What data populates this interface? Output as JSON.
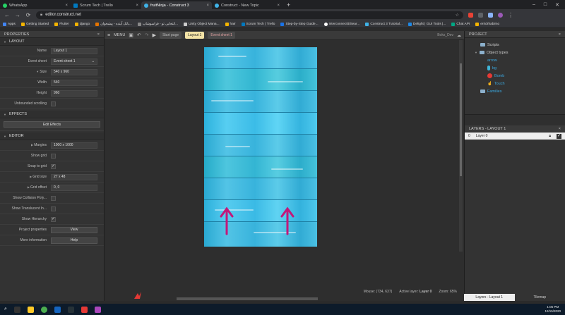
{
  "browser": {
    "tabs": [
      {
        "label": "WhatsApp",
        "color": "#25d366"
      },
      {
        "label": "Scrum Tech | Trello",
        "color": "#0079bf"
      },
      {
        "label": "fruitNinja - Construct 3",
        "color": "#3fb2e6",
        "active": true
      },
      {
        "label": "Construct - New Topic",
        "color": "#3fb2e6"
      }
    ],
    "new_tab": "+",
    "url": "editor.construct.net",
    "bookmarks": [
      "Apps",
      "Getting Started",
      "Flutter",
      "django",
      "بانک آینده - پیشخوان...",
      "انتخابی تو - فراسوشاپ...",
      "Unity Object Mana...",
      "hair",
      "Scrum Tech | Trello",
      "Step-by-Step Guide...",
      "interconnectit/Sear...",
      "Construct 3 Tutorial...",
      "Delight | GUI Tools |...",
      "Chat API",
      "erridrhabimo"
    ]
  },
  "properties": {
    "header": "PROPERTIES",
    "layout_section": "LAYOUT",
    "name_label": "Name",
    "name_value": "Layout 1",
    "event_sheet_label": "Event sheet",
    "event_sheet_value": "Event sheet 1",
    "size_label": "Size",
    "size_value": "540 x 960",
    "width_label": "Width",
    "width_value": "540",
    "height_label": "Height",
    "height_value": "960",
    "unbounded_label": "Unbounded scrolling",
    "effects_section": "EFFECTS",
    "edit_effects": "Edit Effects",
    "editor_section": "EDITOR",
    "margins_label": "Margins",
    "margins_value": "1000 x 1000",
    "show_grid_label": "Show grid",
    "snap_label": "Snap to grid",
    "grid_size_label": "Grid size",
    "grid_size_value": "27 x 48",
    "grid_offset_label": "Grid offset",
    "grid_offset_value": "0, 0",
    "collision_label": "Show Collision Poly...",
    "translucent_label": "Show Translucent In...",
    "hierarchy_label": "Show Hierarchy",
    "project_props_label": "Project properties",
    "view_btn": "View",
    "more_info_label": "More information",
    "help_btn": "Help"
  },
  "editor": {
    "menu": "MENU",
    "tabs": [
      "Start page",
      "Layout 1",
      "Event sheet 1"
    ],
    "user": "Boks_Dev",
    "status": {
      "mouse": "Mouse: (734, 637)",
      "active_layer_label": "Active layer:",
      "active_layer": "Layer 0",
      "zoom": "Zoom: 65%"
    }
  },
  "project": {
    "header": "PROJECT",
    "items": [
      {
        "label": "Scripts",
        "type": "folder"
      },
      {
        "label": "Object types",
        "type": "folder"
      },
      {
        "label": "arrow",
        "type": "object"
      },
      {
        "label": "bg",
        "type": "object"
      },
      {
        "label": "Bomb",
        "type": "object"
      },
      {
        "label": "Touch",
        "type": "object"
      },
      {
        "label": "Families",
        "type": "folder"
      }
    ]
  },
  "layers": {
    "header": "LAYERS - LAYOUT 1",
    "rows": [
      {
        "index": "0",
        "name": "Layer 0"
      }
    ],
    "bottom_tabs": [
      "Layers - Layout 1",
      "Tilemap"
    ]
  },
  "taskbar": {
    "time": "1:05 PM",
    "date": "12/15/2020"
  },
  "colors": {
    "accent_tab": "#f3e3a6",
    "arrow": "#c2187a",
    "canvas_bg": "#3fb6d9"
  }
}
